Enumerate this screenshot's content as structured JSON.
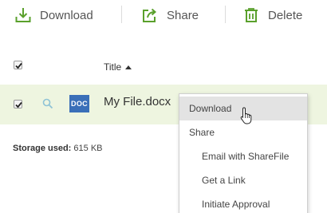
{
  "toolbar": {
    "download_label": "Download",
    "share_label": "Share",
    "delete_label": "Delete",
    "icon_color": "#5aa02c"
  },
  "table": {
    "header": {
      "select_all_checked": true,
      "title_label": "Title",
      "sort": "ascending"
    },
    "rows": [
      {
        "checked": true,
        "type_badge": "DOC",
        "name": "My File.docx"
      }
    ]
  },
  "storage": {
    "label": "Storage used:",
    "value": "615 KB"
  },
  "context_menu": {
    "items": [
      {
        "label": "Download",
        "highlighted": true
      },
      {
        "label": "Share",
        "section_header": true
      },
      {
        "label": "Email with ShareFile"
      },
      {
        "label": "Get a Link"
      },
      {
        "label": "Initiate Approval"
      }
    ]
  },
  "colors": {
    "accent_green": "#5aa02c",
    "selected_row_bg": "#eef5e0",
    "doc_badge_bg": "#3a6fb8",
    "menu_highlight": "#e3e3e3"
  }
}
